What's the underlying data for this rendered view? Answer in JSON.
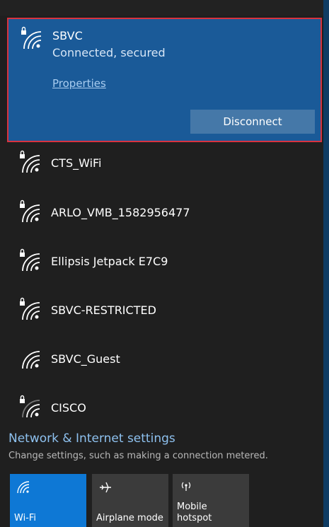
{
  "selected_network": {
    "name": "SBVC",
    "status": "Connected, secured",
    "properties_label": "Properties",
    "disconnect_label": "Disconnect",
    "secured": true
  },
  "networks": [
    {
      "name": "CTS_WiFi",
      "secured": true
    },
    {
      "name": "ARLO_VMB_1582956477",
      "secured": true
    },
    {
      "name": "Ellipsis Jetpack E7C9",
      "secured": true
    },
    {
      "name": "SBVC-RESTRICTED",
      "secured": true
    },
    {
      "name": "SBVC_Guest",
      "secured": false
    },
    {
      "name": "CISCO",
      "secured": true
    }
  ],
  "settings": {
    "link": "Network & Internet settings",
    "description": "Change settings, such as making a connection metered."
  },
  "quick_actions": [
    {
      "label": "Wi-Fi",
      "icon": "wifi-icon",
      "active": true
    },
    {
      "label": "Airplane mode",
      "icon": "airplane-icon",
      "active": false
    },
    {
      "label": "Mobile hotspot",
      "icon": "hotspot-icon",
      "active": false
    }
  ],
  "colors": {
    "background": "#1f1f1f",
    "selected_background": "#1a5a98",
    "highlight_border": "#d8333f",
    "accent": "#0e78d5",
    "link": "#8ec1ef"
  }
}
